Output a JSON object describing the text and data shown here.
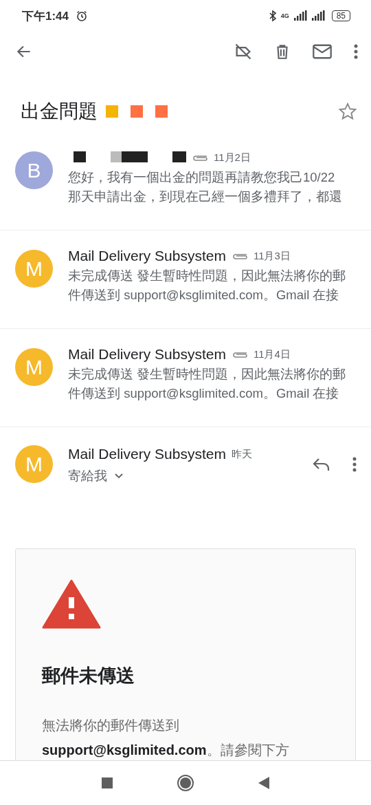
{
  "status_bar": {
    "time": "下午1:44",
    "network": "4G",
    "battery": "85"
  },
  "subject": "出金問題",
  "labels": [
    {
      "color": "#f4b400"
    },
    {
      "color": "#ff7043"
    },
    {
      "color": "#ff7043"
    }
  ],
  "starred": false,
  "messages": [
    {
      "avatar": "B",
      "color": "#9fa8da",
      "sender_redacted": true,
      "attachment": true,
      "date": "11月2日",
      "snippet_lines": [
        "您好，我有一個出金的問題再請教您我己10/22",
        "那天申請出金，到現在己經一個多禮拜了，都還"
      ]
    },
    {
      "avatar": "M",
      "color": "#f6b92b",
      "sender": "Mail Delivery Subsystem",
      "attachment": true,
      "date": "11月3日",
      "snippet_lines": [
        "未完成傳送 發生暫時性問題，因此無法將你的郵",
        "件傳送到 support@ksglimited.com。Gmail 在接"
      ]
    },
    {
      "avatar": "M",
      "color": "#f6b92b",
      "sender": "Mail Delivery Subsystem",
      "attachment": true,
      "date": "11月4日",
      "snippet_lines": [
        "未完成傳送 發生暫時性問題，因此無法將你的郵",
        "件傳送到 support@ksglimited.com。Gmail 在接"
      ]
    }
  ],
  "open_message": {
    "avatar": "M",
    "color": "#f6b92b",
    "sender": "Mail Delivery Subsystem",
    "date": "昨天",
    "recipient": "寄給我"
  },
  "notice": {
    "title": "郵件未傳送",
    "body": "無法將你的郵件傳送到 **support@ksglimited.com**。請參閱下方"
  }
}
